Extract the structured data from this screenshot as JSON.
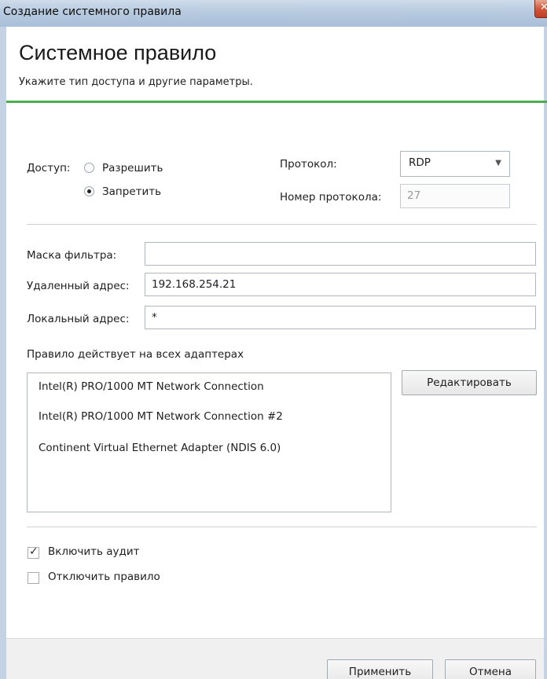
{
  "window": {
    "title": "Создание системного правила",
    "close_glyph": "✕"
  },
  "header": {
    "title": "Системное правило",
    "subtitle": "Укажите тип доступа и другие параметры."
  },
  "access": {
    "label": "Доступ:",
    "options": [
      {
        "label": "Разрешить",
        "selected": false
      },
      {
        "label": "Запретить",
        "selected": true
      }
    ]
  },
  "protocol": {
    "label": "Протокол:",
    "value": "RDP",
    "number_label": "Номер протокола:",
    "number_value": "27"
  },
  "fields": {
    "filter_mask_label": "Маска фильтра:",
    "filter_mask_value": "",
    "remote_address_label": "Удаленный адрес:",
    "remote_address_value": "192.168.254.21",
    "local_address_label": "Локальный адрес:",
    "local_address_value": "*"
  },
  "adapters": {
    "caption": "Правило действует на всех адаптерах",
    "items": [
      "Intel(R) PRO/1000 MT Network Connection",
      "Intel(R) PRO/1000 MT Network Connection #2",
      "Continent Virtual Ethernet Adapter (NDIS 6.0)"
    ],
    "edit_button": "Редактировать"
  },
  "options": {
    "audit_label": "Включить аудит",
    "audit_checked": true,
    "disable_label": "Отключить правило",
    "disable_checked": false
  },
  "footer": {
    "apply_button": "Применить",
    "cancel_button": "Отмена"
  },
  "colors": {
    "accent_line": "#4cae4c",
    "titlebar": "#b7cadf",
    "close_button": "#c23d22"
  },
  "icons": {
    "dropdown": "chevron-down-icon",
    "checkmark": "check-icon",
    "close": "close-icon"
  }
}
